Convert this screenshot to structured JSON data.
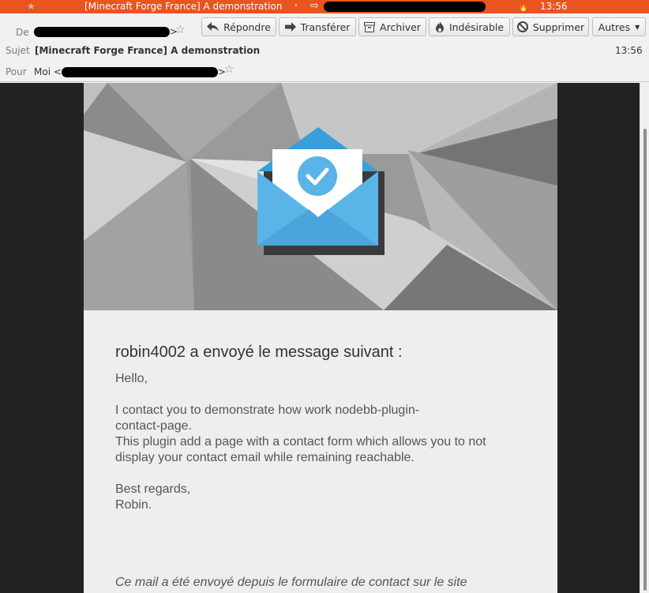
{
  "window": {
    "tab_title": "[Minecraft Forge France] A demonstration",
    "tab_time": "13:56"
  },
  "header": {
    "from_label": "De",
    "subject_label": "Sujet",
    "subject_value": "[Minecraft Forge France] A demonstration",
    "time": "13:56",
    "to_label": "Pour",
    "to_value": "Moi <",
    "addr_close": ">"
  },
  "toolbar": {
    "reply": "Répondre",
    "forward": "Transférer",
    "archive": "Archiver",
    "junk": "Indésirable",
    "delete": "Supprimer",
    "more": "Autres"
  },
  "email": {
    "heading": "robin4002 a envoyé le message suivant :",
    "greeting": "Hello,",
    "body_line1": "I contact you to demonstrate how work nodebb-plugin-",
    "body_line2": "contact-page.",
    "body_line3": "This plugin add a page with a contact form which allows you to not",
    "body_line4": "display your contact email while remaining reachable.",
    "regards": "Best regards,",
    "signature": "Robin.",
    "footer": "Ce mail a été envoyé depuis le formulaire de contact sur le site"
  },
  "icons": {
    "banner": "envelope-checkmark-icon",
    "accent": "#e9541f",
    "envelope": "#5ab4e8"
  }
}
